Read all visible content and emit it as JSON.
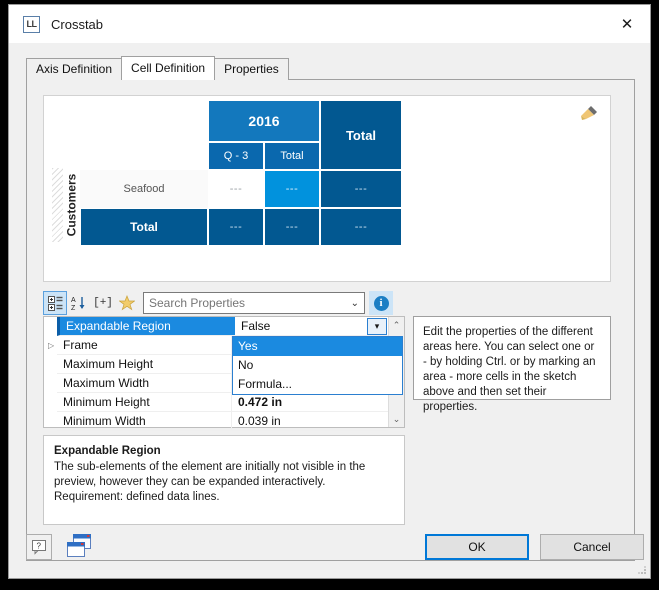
{
  "window": {
    "title": "Crosstab",
    "icon_label": "LL",
    "icon_name": "ll-app-icon",
    "close_label": "✕"
  },
  "tabs": [
    {
      "label": "Axis Definition",
      "active": false
    },
    {
      "label": "Cell Definition",
      "active": true
    },
    {
      "label": "Properties",
      "active": false
    }
  ],
  "preview": {
    "brush_icon": "paintbrush-icon",
    "axis_label": "Customers",
    "crosstab": {
      "year_header": "2016",
      "total_header": "Total",
      "sub_headers": [
        "Q - 3",
        "Total"
      ],
      "row_labels": [
        "Seafood",
        "Total"
      ],
      "data_placeholder": "---",
      "rows": [
        {
          "label": "Seafood",
          "cells": [
            "---",
            "---",
            "---"
          ]
        },
        {
          "label": "Total",
          "cells": [
            "---",
            "---",
            "---"
          ]
        }
      ],
      "colors": {
        "year_header": "#1378bd",
        "sub_header": "#0a68ae",
        "total_header": "#025891",
        "data": "#025891",
        "selected_cell": "#0192dd",
        "row_label": "#fafafa"
      }
    }
  },
  "property_toolbar": {
    "categorized_icon": "categorized-view-icon",
    "alphabetical_icon": "alphabetical-sort-icon",
    "expand_label": "[+]",
    "favorites_icon": "star-icon",
    "search_placeholder": "Search Properties",
    "search_value": "",
    "chevron": "⌄",
    "info_label": "i"
  },
  "property_grid": {
    "rows": [
      {
        "name": "Expandable Region",
        "value": "False",
        "selected": true,
        "expandable": false,
        "bold": false
      },
      {
        "name": "Frame",
        "value": "",
        "selected": false,
        "expandable": true,
        "bold": false
      },
      {
        "name": "Maximum Height",
        "value": "",
        "selected": false,
        "expandable": false,
        "bold": false
      },
      {
        "name": "Maximum Width",
        "value": "",
        "selected": false,
        "expandable": false,
        "bold": false
      },
      {
        "name": "Minimum Height",
        "value": "0.472 in",
        "selected": false,
        "expandable": false,
        "bold": true
      },
      {
        "name": "Minimum Width",
        "value": "0.039 in",
        "selected": false,
        "expandable": false,
        "bold": false
      }
    ],
    "dropdown": {
      "open": true,
      "options": [
        "Yes",
        "No",
        "Formula..."
      ],
      "highlighted": "Yes"
    },
    "scroll_up": "⌃",
    "scroll_down": "⌄"
  },
  "help_panel": {
    "text": "Edit the properties of the different areas here. You can select one or - by holding Ctrl. or by marking an area - more cells in the sketch above and then set their properties."
  },
  "description_panel": {
    "title": "Expandable Region",
    "body": "The sub-elements of the element are initially not visible in the preview, however they can be expanded interactively. Requirement: defined data lines."
  },
  "bottom_bar": {
    "help_icon": "question-mark-icon",
    "windows_icon": "cascade-windows-icon",
    "ok_label": "OK",
    "cancel_label": "Cancel"
  }
}
